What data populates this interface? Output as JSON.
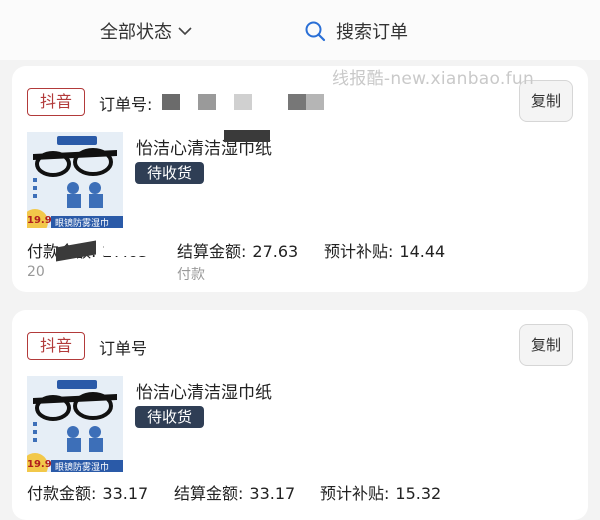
{
  "header": {
    "status_filter": "全部状态",
    "search_placeholder": "搜索订单"
  },
  "watermark": "线报酷-new.xianbao.fun",
  "orders": [
    {
      "platform": "抖音",
      "order_no_label": "订单号:",
      "copy_label": "复制",
      "product_title": "怡洁心清洁湿巾纸",
      "status": "待收货",
      "pay_label": "付款金额:",
      "pay_value": "27.63",
      "settle_label": "结算金额:",
      "settle_value": "27.63",
      "subsidy_label": "预计补贴:",
      "subsidy_value": "14.44",
      "sub_left": "20",
      "sub_mid": "付款",
      "thumb_price": "19.9",
      "thumb_banner": "眼镜防雾湿巾"
    },
    {
      "platform": "抖音",
      "order_no_label": "订单号",
      "copy_label": "复制",
      "product_title": "怡洁心清洁湿巾纸",
      "status": "待收货",
      "pay_label": "付款金额:",
      "pay_value": "33.17",
      "settle_label": "结算金额:",
      "settle_value": "33.17",
      "subsidy_label": "预计补贴:",
      "subsidy_value": "15.32",
      "thumb_price": "19.9",
      "thumb_banner": "眼镜防雾湿巾"
    }
  ],
  "colors": {
    "platform_red": "#b23a3a",
    "badge_navy": "#2f3e55",
    "background": "#f3f3f3"
  }
}
